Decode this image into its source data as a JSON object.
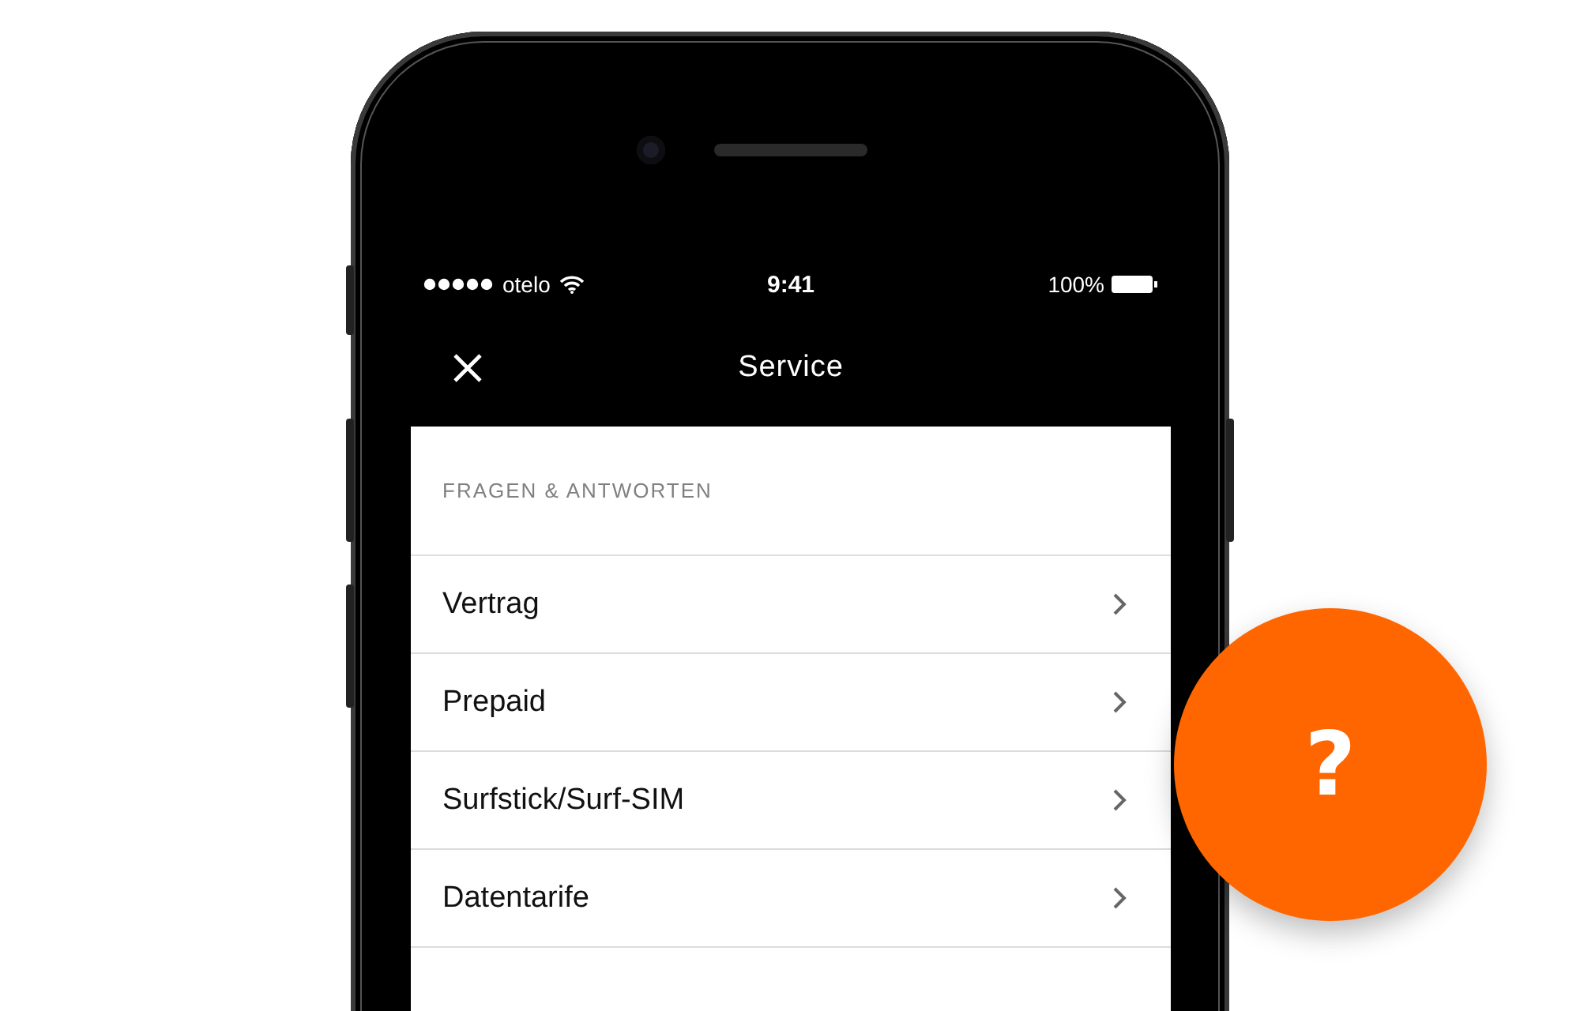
{
  "status_bar": {
    "carrier": "otelo",
    "time": "9:41",
    "battery": "100%"
  },
  "nav_bar": {
    "title": "Service"
  },
  "section": {
    "heading": "FRAGEN & ANTWORTEN",
    "items": [
      {
        "label": "Vertrag"
      },
      {
        "label": "Prepaid"
      },
      {
        "label": "Surfstick/Surf-SIM"
      },
      {
        "label": "Datentarife"
      }
    ]
  },
  "help_button": {
    "label": "?"
  }
}
